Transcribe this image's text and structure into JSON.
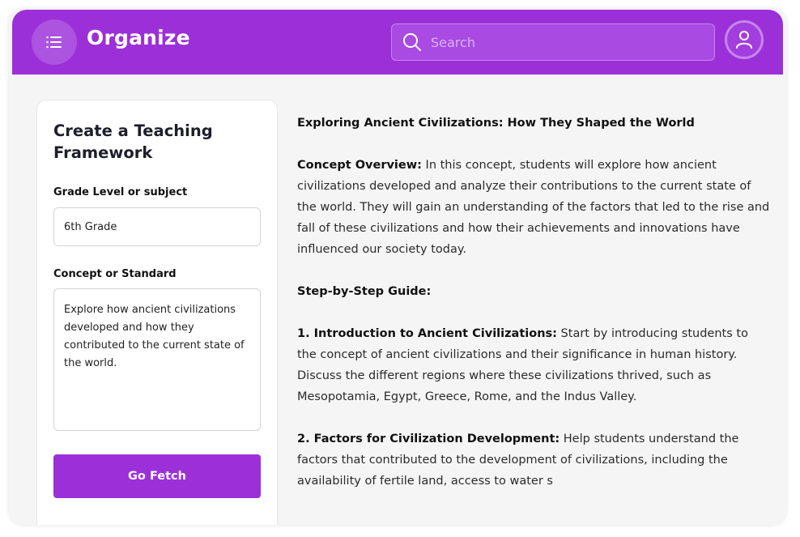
{
  "app": {
    "name": "Organize"
  },
  "header": {
    "menu_icon": "list-icon",
    "search_placeholder": "Search",
    "search_icon": "search-icon",
    "profile_icon": "user-icon"
  },
  "form": {
    "title": "Create a Teaching Framework",
    "grade_label": "Grade Level or subject",
    "grade_value": "6th Grade",
    "concept_label": "Concept or Standard",
    "concept_value": "Explore how ancient civilizations developed and how they contributed to the current state of the world.",
    "submit_label": "Go Fetch"
  },
  "output": {
    "title": "Exploring Ancient Civilizations: How They Shaped the World",
    "overview_heading": "Concept Overview:",
    "overview_text": " In this concept, students will explore how ancient civilizations developed and analyze their contributions to the current state of the world. They will gain an understanding of the factors that led to the rise and fall of these civilizations and how their achievements and innovations have influenced our society today.",
    "guide_heading": "Step-by-Step Guide:",
    "steps": [
      {
        "heading": "1. Introduction to Ancient Civilizations:",
        "text": " Start by introducing students to the concept of ancient civilizations and their significance in human history. Discuss the different regions where these civilizations thrived, such as Mesopotamia, Egypt, Greece, Rome, and the Indus Valley."
      },
      {
        "heading": "2. Factors for Civilization Development:",
        "text": " Help students understand the factors that contributed to the development of civilizations, including the availability of fertile land, access to water s"
      }
    ]
  },
  "colors": {
    "primary": "#9b30d9",
    "background": "#f5f5f5"
  }
}
